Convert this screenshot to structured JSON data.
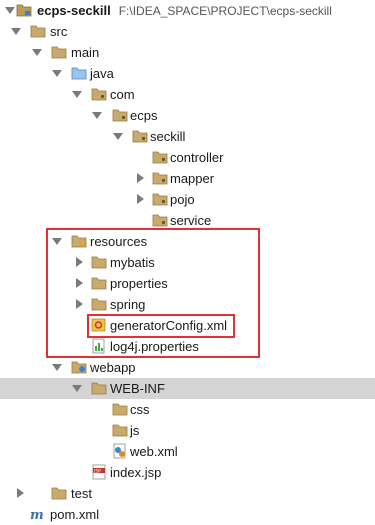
{
  "tree": [
    {
      "name": "ecps-seckill",
      "path": "F:\\IDEA_SPACE\\PROJECT\\ecps-seckill",
      "icon": "module-folder-icon",
      "expanded": true
    },
    {
      "name": "src",
      "icon": "folder-icon",
      "expanded": true
    },
    {
      "name": "main",
      "icon": "folder-icon",
      "expanded": true
    },
    {
      "name": "java",
      "icon": "source-root-folder-icon",
      "expanded": true
    },
    {
      "name": "com",
      "icon": "package-folder-icon",
      "expanded": true
    },
    {
      "name": "ecps",
      "icon": "package-folder-icon",
      "expanded": true
    },
    {
      "name": "seckill",
      "icon": "package-folder-icon",
      "expanded": true
    },
    {
      "name": "controller",
      "icon": "package-folder-icon"
    },
    {
      "name": "mapper",
      "icon": "package-folder-icon",
      "expanded": false
    },
    {
      "name": "pojo",
      "icon": "package-folder-icon",
      "expanded": false
    },
    {
      "name": "service",
      "icon": "package-folder-icon"
    },
    {
      "name": "resources",
      "icon": "resources-folder-icon",
      "expanded": true
    },
    {
      "name": "mybatis",
      "icon": "folder-icon",
      "expanded": false
    },
    {
      "name": "properties",
      "icon": "folder-icon",
      "expanded": false
    },
    {
      "name": "spring",
      "icon": "folder-icon",
      "expanded": false
    },
    {
      "name": "generatorConfig.xml",
      "icon": "xml-file-icon"
    },
    {
      "name": "log4j.properties",
      "icon": "properties-file-icon"
    },
    {
      "name": "webapp",
      "icon": "web-folder-icon",
      "expanded": true
    },
    {
      "name": "WEB-INF",
      "icon": "folder-icon",
      "expanded": true,
      "selected": true
    },
    {
      "name": "css",
      "icon": "folder-icon"
    },
    {
      "name": "js",
      "icon": "folder-icon"
    },
    {
      "name": "web.xml",
      "icon": "web-xml-file-icon"
    },
    {
      "name": "index.jsp",
      "icon": "jsp-file-icon"
    },
    {
      "name": "test",
      "icon": "folder-icon",
      "expanded": false
    },
    {
      "name": "pom.xml",
      "icon": "maven-file-icon"
    }
  ]
}
